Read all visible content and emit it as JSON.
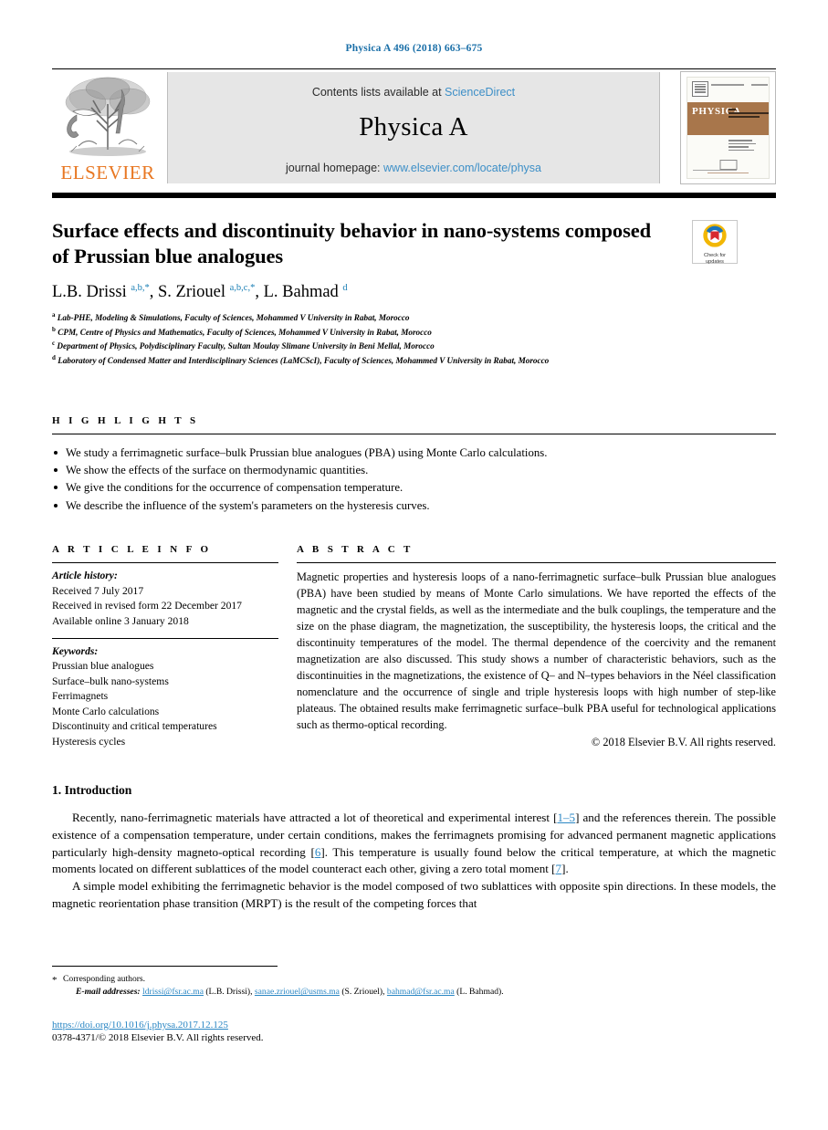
{
  "running_head": "Physica A 496 (2018) 663–675",
  "masthead": {
    "contents_prefix": "Contents lists available at ",
    "contents_link": "ScienceDirect",
    "journal_title": "Physica A",
    "homepage_prefix": "journal homepage: ",
    "homepage_link": "www.elsevier.com/locate/physa",
    "publisher_wordmark": "ELSEVIER",
    "cover": {
      "title": "PHYSICA",
      "subtitle": "STATISTICAL MECHANICS AND ITS APPLICATIONS"
    }
  },
  "crossmark": {
    "line1": "Check for",
    "line2": "updates"
  },
  "article": {
    "title": "Surface effects and discontinuity behavior in nano-systems composed of Prussian blue analogues",
    "authors_html": "L.B. Drissi <sup>a,b,*</sup>, S. Zriouel <sup>a,b,c,*</sup>, L. Bahmad <sup>d</sup>",
    "affiliations": [
      {
        "mark": "a",
        "text": "Lab-PHE, Modeling & Simulations, Faculty of Sciences, Mohammed V University in Rabat, Morocco"
      },
      {
        "mark": "b",
        "text": "CPM, Centre of Physics and Mathematics, Faculty of Sciences, Mohammed V University in Rabat, Morocco"
      },
      {
        "mark": "c",
        "text": "Department of Physics, Polydisciplinary Faculty, Sultan Moulay Slimane University in Beni Mellal, Morocco"
      },
      {
        "mark": "d",
        "text": "Laboratory of Condensed Matter and Interdisciplinary Sciences (LaMCScI), Faculty of Sciences, Mohammed V University in Rabat, Morocco"
      }
    ]
  },
  "highlights": {
    "label": "H I G H L I G H T S",
    "items": [
      "We study a ferrimagnetic surface–bulk Prussian blue analogues (PBA) using Monte Carlo calculations.",
      "We show the effects of the surface on thermodynamic quantities.",
      "We give the conditions for the occurrence of compensation temperature.",
      "We describe the influence of the system's parameters on the hysteresis curves."
    ]
  },
  "article_info": {
    "label": "A R T I C L E   I N F O",
    "history_label": "Article history:",
    "history": [
      "Received 7 July 2017",
      "Received in revised form 22 December 2017",
      "Available online 3 January 2018"
    ],
    "keywords_label": "Keywords:",
    "keywords": [
      "Prussian blue analogues",
      "Surface–bulk nano-systems",
      "Ferrimagnets",
      "Monte Carlo calculations",
      "Discontinuity and critical temperatures",
      "Hysteresis cycles"
    ]
  },
  "abstract": {
    "label": "A B S T R A C T",
    "text": "Magnetic properties and hysteresis loops of a nano-ferrimagnetic surface–bulk Prussian blue analogues (PBA) have been studied by means of Monte Carlo simulations. We have reported the effects of the magnetic and the crystal fields, as well as the intermediate and the bulk couplings, the temperature and the size on the phase diagram, the magnetization, the susceptibility, the hysteresis loops, the critical and the discontinuity temperatures of the model. The thermal dependence of the coercivity and the remanent magnetization are also discussed. This study shows a number of characteristic behaviors, such as the discontinuities in the magnetizations, the existence of Q– and N–types behaviors in the Néel classification nomenclature and the occurrence of single and triple hysteresis loops with high number of step-like plateaus. The obtained results make ferrimagnetic surface–bulk PBA useful for technological applications such as thermo-optical recording.",
    "copyright": "© 2018 Elsevier B.V. All rights reserved."
  },
  "introduction": {
    "heading": "1. Introduction",
    "paragraph1_parts": [
      "Recently, nano-ferrimagnetic materials have attracted a lot of theoretical and experimental interest [",
      "1–5",
      "] and the references therein. The possible existence of a compensation temperature, under certain conditions, makes the ferrimagnets promising for advanced permanent magnetic applications particularly high-density magneto-optical recording [",
      "6",
      "]. This temperature is usually found below the critical temperature, at which the magnetic moments located on different sublattices of the model counteract each other, giving a zero total moment [",
      "7",
      "]."
    ],
    "paragraph2": "A simple model exhibiting the ferrimagnetic behavior is the model composed of two sublattices with opposite spin directions. In these models, the magnetic reorientation phase transition (MRPT) is the result of the competing forces that"
  },
  "footer": {
    "corresponding": "Corresponding authors.",
    "email_label": "E-mail addresses:",
    "emails": [
      {
        "address": "ldrissi@fsr.ac.ma",
        "owner": "(L.B. Drissi)"
      },
      {
        "address": "sanae.zriouel@usms.ma",
        "owner": "(S. Zriouel)"
      },
      {
        "address": "bahmad@fsr.ac.ma",
        "owner": "(L. Bahmad)"
      }
    ],
    "doi": "https://doi.org/10.1016/j.physa.2017.12.125",
    "issn": "0378-4371/© 2018 Elsevier B.V. All rights reserved."
  },
  "colors": {
    "link_blue": "#3d8fc7",
    "citation_blue": "#2b87c4",
    "elsevier_orange": "#E87722",
    "cover_band": "#A8764B"
  }
}
